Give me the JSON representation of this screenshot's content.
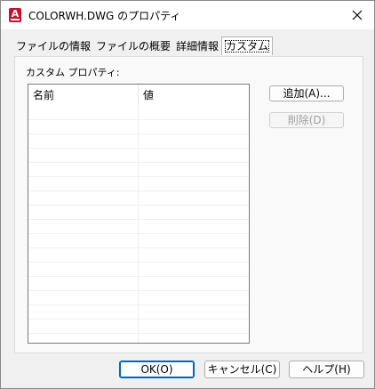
{
  "window": {
    "title": "COLORWH.DWG のプロパティ",
    "app_icon": "A"
  },
  "tabs": [
    {
      "label": "ファイルの情報"
    },
    {
      "label": "ファイルの概要"
    },
    {
      "label": "詳細情報"
    },
    {
      "label": "カスタム",
      "active": true
    }
  ],
  "custom": {
    "group_label": "カスタム プロパティ:",
    "columns": [
      "名前",
      "値"
    ],
    "add_button": "追加(A)...",
    "delete_button": "削除(D)"
  },
  "footer": {
    "ok": "OK(O)",
    "cancel": "キャンセル(C)",
    "help": "ヘルプ(H)"
  },
  "colors": {
    "accent": "#0067c0",
    "app_icon_red": "#c8102e"
  }
}
